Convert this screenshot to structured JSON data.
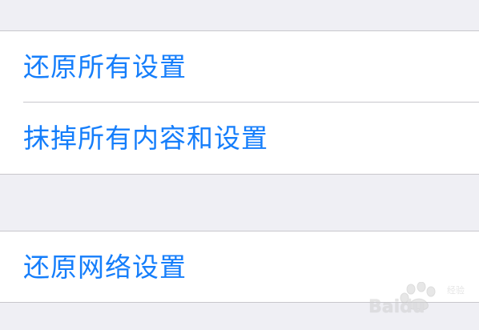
{
  "settings_group_reset": {
    "items": [
      {
        "label": "还原所有设置"
      },
      {
        "label": "抹掉所有内容和设置"
      }
    ]
  },
  "settings_group_network": {
    "items": [
      {
        "label": "还原网络设置"
      }
    ]
  },
  "colors": {
    "background": "#efeff4",
    "row_background": "#ffffff",
    "link_blue": "#157efb",
    "separator": "#c8c7cc"
  },
  "watermark": {
    "text": "Baidu",
    "suffix": "经验",
    "icon": "baidu-paw-icon"
  }
}
